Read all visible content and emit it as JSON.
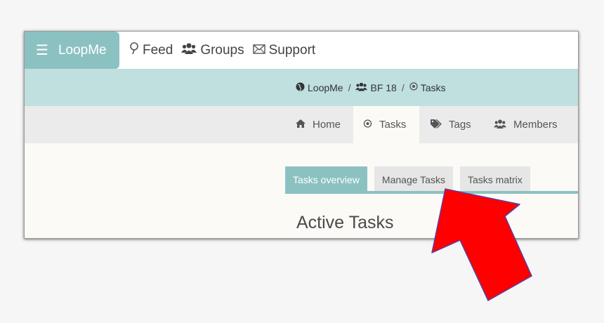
{
  "navbar": {
    "brand": "LoopMe",
    "links": [
      {
        "label": "Feed",
        "icon": "map-pin-icon"
      },
      {
        "label": "Groups",
        "icon": "users-icon"
      },
      {
        "label": "Support",
        "icon": "envelope-icon"
      }
    ]
  },
  "breadcrumb": {
    "items": [
      {
        "label": "LoopMe",
        "icon": "globe-icon"
      },
      {
        "label": "BF 18",
        "icon": "users-icon"
      },
      {
        "label": "Tasks",
        "icon": "target-icon"
      }
    ],
    "separator": "/"
  },
  "section_nav": {
    "tabs": [
      {
        "label": "Home",
        "icon": "home-icon"
      },
      {
        "label": "Tasks",
        "icon": "target-icon"
      },
      {
        "label": "Tags",
        "icon": "tags-icon"
      },
      {
        "label": "Members",
        "icon": "users-icon"
      }
    ],
    "active": "Tasks"
  },
  "subtabs": {
    "items": [
      "Tasks overview",
      "Manage Tasks",
      "Tasks matrix"
    ],
    "active": "Tasks overview"
  },
  "main": {
    "heading": "Active Tasks"
  },
  "colors": {
    "accent": "#8cc1c2",
    "breadcrumb_bg": "#c0dfdf",
    "arrow": "#ff0000"
  }
}
